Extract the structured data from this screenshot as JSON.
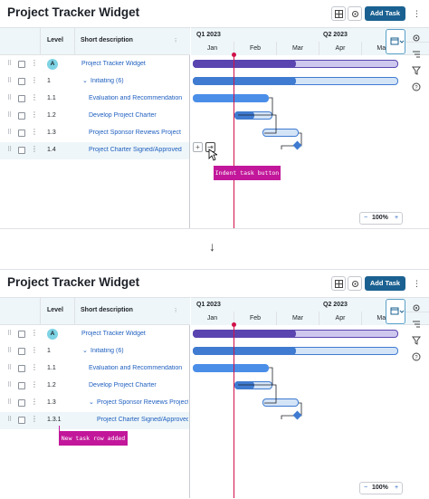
{
  "widget_title": "Project Tracker Widget",
  "add_task_label": "Add Task",
  "kebab_glyph": "⋮",
  "grid": {
    "col_level": "Level",
    "col_desc": "Short description"
  },
  "timeline": {
    "quarters": [
      "Q1 2023",
      "Q2 2023"
    ],
    "months": [
      "Jan",
      "Feb",
      "Mar",
      "Apr",
      "May"
    ]
  },
  "zoom": {
    "minus": "−",
    "value": "100%",
    "plus": "+"
  },
  "top": {
    "rows": [
      {
        "level": "A",
        "desc": "Project Tracker Widget"
      },
      {
        "level": "1",
        "desc": "Initiating (6)"
      },
      {
        "level": "1.1",
        "desc": "Evaluation and Recommendation"
      },
      {
        "level": "1.2",
        "desc": "Develop Project Charter"
      },
      {
        "level": "1.3",
        "desc": "Project Sponsor Reviews Project"
      },
      {
        "level": "1.4",
        "desc": "Project Charter Signed/Approved"
      }
    ],
    "callout": "Indent task button",
    "row_buttons": {
      "add": "+",
      "indent": "⇥"
    }
  },
  "bottom": {
    "rows": [
      {
        "level": "A",
        "desc": "Project Tracker Widget"
      },
      {
        "level": "1",
        "desc": "Initiating (6)"
      },
      {
        "level": "1.1",
        "desc": "Evaluation and Recommendation"
      },
      {
        "level": "1.2",
        "desc": "Develop Project Charter"
      },
      {
        "level": "1.3",
        "desc": "Project Sponsor Reviews Project"
      },
      {
        "level": "1.3.1",
        "desc": "Project Charter Signed/Approved"
      }
    ],
    "callout": "New task row added"
  },
  "transition_arrow": "↓",
  "colors": {
    "accent": "#1a6191",
    "summary_bar": "#5a45b0",
    "summary_bar_light": "#cfc8ee",
    "phase_bar": "#3f7bd0",
    "task_bar": "#4a8ee8",
    "today_line": "#d1114a",
    "callout": "#c2179a"
  }
}
